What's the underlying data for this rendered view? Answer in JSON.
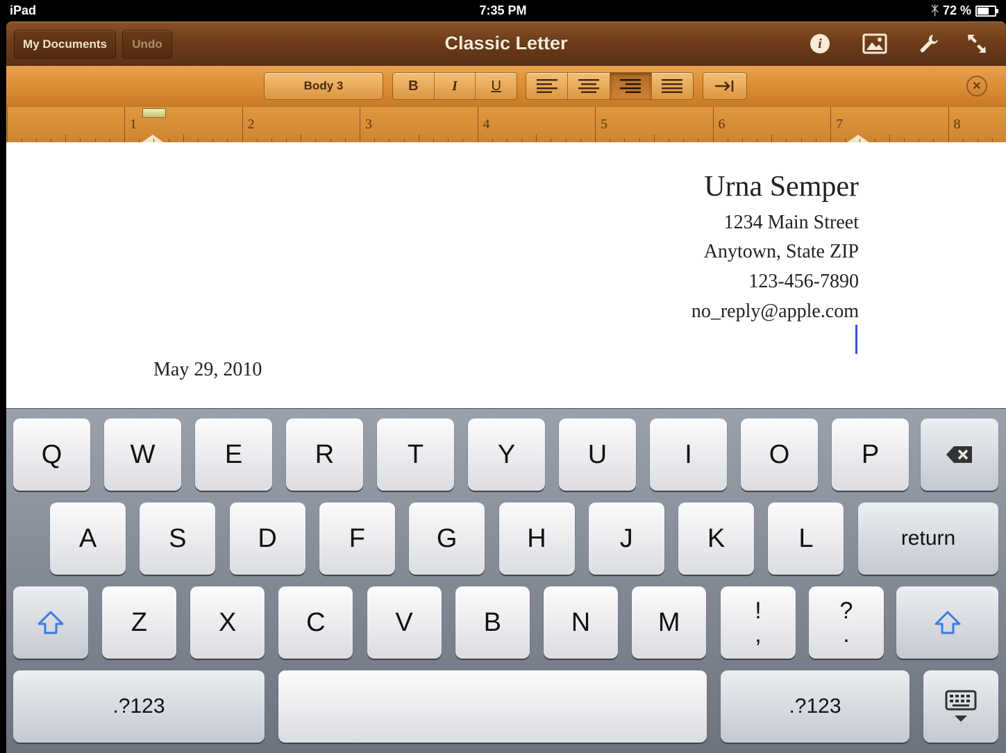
{
  "status_bar": {
    "device": "iPad",
    "time": "7:35 PM",
    "battery": "72 %",
    "battery_level": 0.72
  },
  "toolbar": {
    "my_documents": "My Documents",
    "undo": "Undo",
    "title": "Classic Letter"
  },
  "format_bar": {
    "style": "Body 3",
    "bold": "B",
    "italic": "I",
    "underline": "U",
    "selected_alignment": "right"
  },
  "ruler": {
    "numbers": [
      "1",
      "2",
      "3",
      "4",
      "5",
      "6",
      "7",
      "8"
    ]
  },
  "document": {
    "name": "Urna Semper",
    "street": "1234 Main Street",
    "city": "Anytown, State ZIP",
    "phone": "123-456-7890",
    "email": "no_reply@apple.com",
    "date": "May 29, 2010"
  },
  "keyboard": {
    "row1": [
      "Q",
      "W",
      "E",
      "R",
      "T",
      "Y",
      "U",
      "I",
      "O",
      "P"
    ],
    "row2": [
      "A",
      "S",
      "D",
      "F",
      "G",
      "H",
      "J",
      "K",
      "L"
    ],
    "row3": [
      "Z",
      "X",
      "C",
      "V",
      "B",
      "N",
      "M"
    ],
    "return": "return",
    "excl": "!",
    "comma": ",",
    "question": "?",
    "period": ".",
    "numbers_left": ".?123",
    "numbers_right": ".?123"
  }
}
